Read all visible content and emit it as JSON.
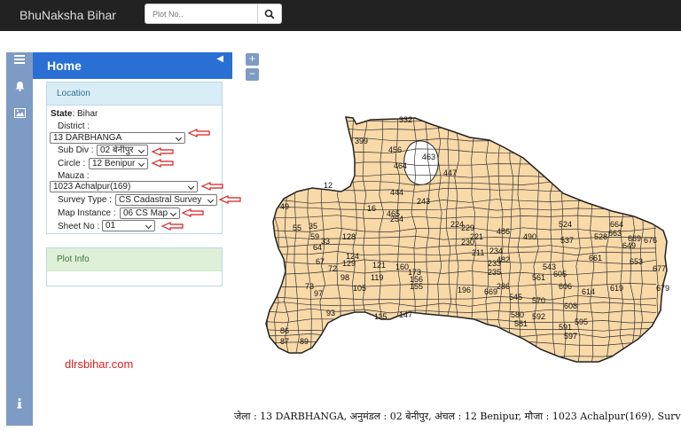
{
  "header": {
    "brand": "BhuNaksha Bihar",
    "search_placeholder": "Plot No.."
  },
  "sidebar": {
    "home_title": "Home",
    "icons": [
      "menu-icon",
      "bell-icon",
      "image-icon",
      "info-icon"
    ]
  },
  "location": {
    "heading": "Location",
    "state_label": "State",
    "state_value": ": Bihar",
    "district_label": "District :",
    "district_value": "13 DARBHANGA",
    "subdiv_label": "Sub Div :",
    "subdiv_value": "02 बेनीपुर",
    "circle_label": "Circle :",
    "circle_value": "12 Benipur",
    "mauza_label": "Mauza :",
    "mauza_value": "1023 Achalpur(169)",
    "survey_label": "Survey Type :",
    "survey_value": "CS Cadastral Survey",
    "map_label": "Map Instance :",
    "map_value": "06 CS Map",
    "sheet_label": "Sheet No :",
    "sheet_value": "01"
  },
  "plot_info": {
    "heading": "Plot Info"
  },
  "zoom": {
    "in": "+",
    "out": "−"
  },
  "watermark": "dlrsbihar.com",
  "status_bar": "जेला : 13 DARBHANGA, अनुमंडल : 02 बेनीपुर, अंचल : 12 Benipur, मौजा : 1023 Achalpur(169), Survey Type :",
  "map": {
    "fill_color": "#f8d9a8",
    "line_color": "#222222",
    "plot_labels": [
      "332",
      "399",
      "456",
      "463",
      "464",
      "447",
      "444",
      "243",
      "465",
      "224",
      "254",
      "173",
      "16",
      "12",
      "35",
      "33",
      "49",
      "55",
      "59",
      "64",
      "128",
      "67",
      "72",
      "129",
      "229",
      "230",
      "221",
      "211",
      "234",
      "486",
      "482",
      "490",
      "524",
      "537",
      "528",
      "663",
      "664",
      "669",
      "649",
      "676",
      "653",
      "677",
      "661",
      "543",
      "561",
      "605",
      "606",
      "614",
      "619",
      "679",
      "73",
      "97",
      "93",
      "98",
      "119",
      "121",
      "160",
      "155",
      "156",
      "196",
      "233",
      "235",
      "286",
      "669",
      "545",
      "570",
      "592",
      "608",
      "580",
      "581",
      "591",
      "597",
      "595",
      "115",
      "147",
      "86",
      "87",
      "89",
      "124",
      "105"
    ]
  },
  "colors": {
    "topbar": "#222222",
    "home_bar": "#2a6fd4",
    "rail": "#7d9bc5",
    "arrows": "#d61e1e"
  }
}
